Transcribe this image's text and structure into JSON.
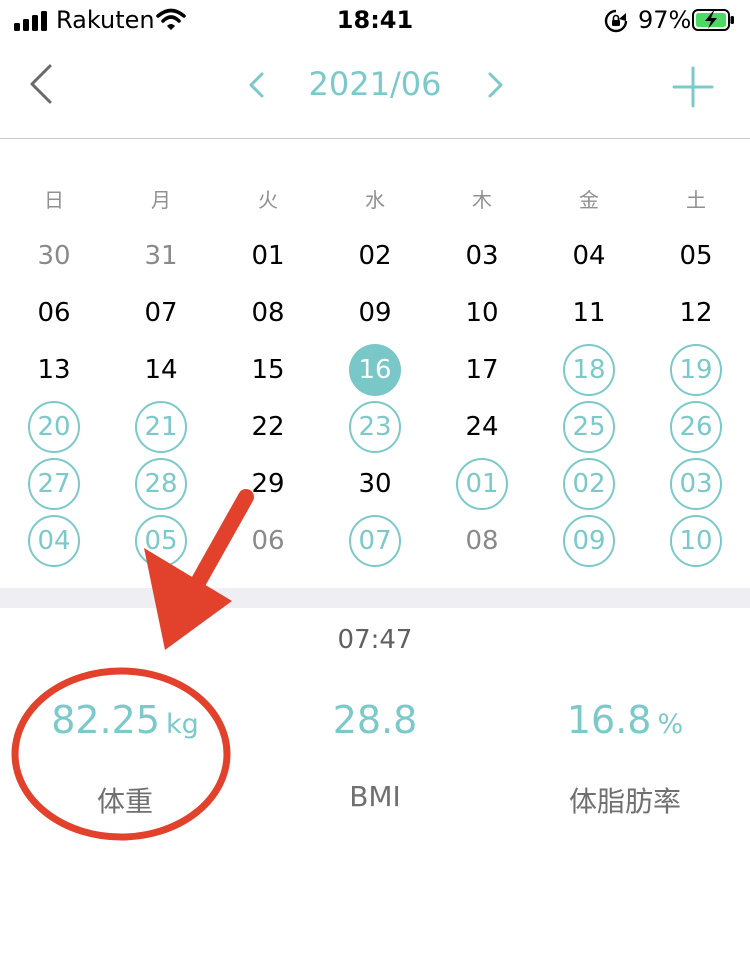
{
  "status_bar": {
    "carrier": "Rakuten",
    "time": "18:41",
    "battery": "97%",
    "icons": [
      "signal-icon",
      "wifi-icon",
      "rotation-lock-icon",
      "battery-charging-icon"
    ]
  },
  "nav": {
    "back_icon": "chevron-left-icon",
    "prev_icon": "chevron-left-icon",
    "month": "2021/06",
    "next_icon": "chevron-right-icon",
    "add_icon": "plus-icon"
  },
  "calendar": {
    "weekdays": [
      "日",
      "月",
      "火",
      "水",
      "木",
      "金",
      "土"
    ],
    "weeks": [
      [
        {
          "d": "30",
          "s": "outside"
        },
        {
          "d": "31",
          "s": "outside"
        },
        {
          "d": "01",
          "s": "normal"
        },
        {
          "d": "02",
          "s": "normal"
        },
        {
          "d": "03",
          "s": "normal"
        },
        {
          "d": "04",
          "s": "normal"
        },
        {
          "d": "05",
          "s": "normal"
        }
      ],
      [
        {
          "d": "06",
          "s": "normal"
        },
        {
          "d": "07",
          "s": "normal"
        },
        {
          "d": "08",
          "s": "normal"
        },
        {
          "d": "09",
          "s": "normal"
        },
        {
          "d": "10",
          "s": "normal"
        },
        {
          "d": "11",
          "s": "normal"
        },
        {
          "d": "12",
          "s": "normal"
        }
      ],
      [
        {
          "d": "13",
          "s": "normal"
        },
        {
          "d": "14",
          "s": "normal"
        },
        {
          "d": "15",
          "s": "normal"
        },
        {
          "d": "16",
          "s": "selected"
        },
        {
          "d": "17",
          "s": "normal"
        },
        {
          "d": "18",
          "s": "recorded"
        },
        {
          "d": "19",
          "s": "recorded"
        }
      ],
      [
        {
          "d": "20",
          "s": "recorded"
        },
        {
          "d": "21",
          "s": "recorded"
        },
        {
          "d": "22",
          "s": "normal"
        },
        {
          "d": "23",
          "s": "recorded"
        },
        {
          "d": "24",
          "s": "normal"
        },
        {
          "d": "25",
          "s": "recorded"
        },
        {
          "d": "26",
          "s": "recorded"
        }
      ],
      [
        {
          "d": "27",
          "s": "recorded"
        },
        {
          "d": "28",
          "s": "recorded"
        },
        {
          "d": "29",
          "s": "normal"
        },
        {
          "d": "30",
          "s": "normal"
        },
        {
          "d": "01",
          "s": "recorded"
        },
        {
          "d": "02",
          "s": "recorded"
        },
        {
          "d": "03",
          "s": "recorded"
        }
      ],
      [
        {
          "d": "04",
          "s": "recorded"
        },
        {
          "d": "05",
          "s": "recorded"
        },
        {
          "d": "06",
          "s": "outside"
        },
        {
          "d": "07",
          "s": "recorded"
        },
        {
          "d": "08",
          "s": "outside"
        },
        {
          "d": "09",
          "s": "recorded"
        },
        {
          "d": "10",
          "s": "recorded"
        }
      ]
    ]
  },
  "measurement": {
    "time": "07:47",
    "weight": {
      "value": "82.25",
      "unit": "kg",
      "label": "体重"
    },
    "bmi": {
      "value": "28.8",
      "label": "BMI"
    },
    "body_fat": {
      "value": "16.8",
      "unit": "%",
      "label": "体脂肪率"
    }
  },
  "colors": {
    "accent": "#7cc9c9",
    "selected_fill": "#79c7c7",
    "annotation": "#e2412b",
    "band": "#efeff3"
  }
}
